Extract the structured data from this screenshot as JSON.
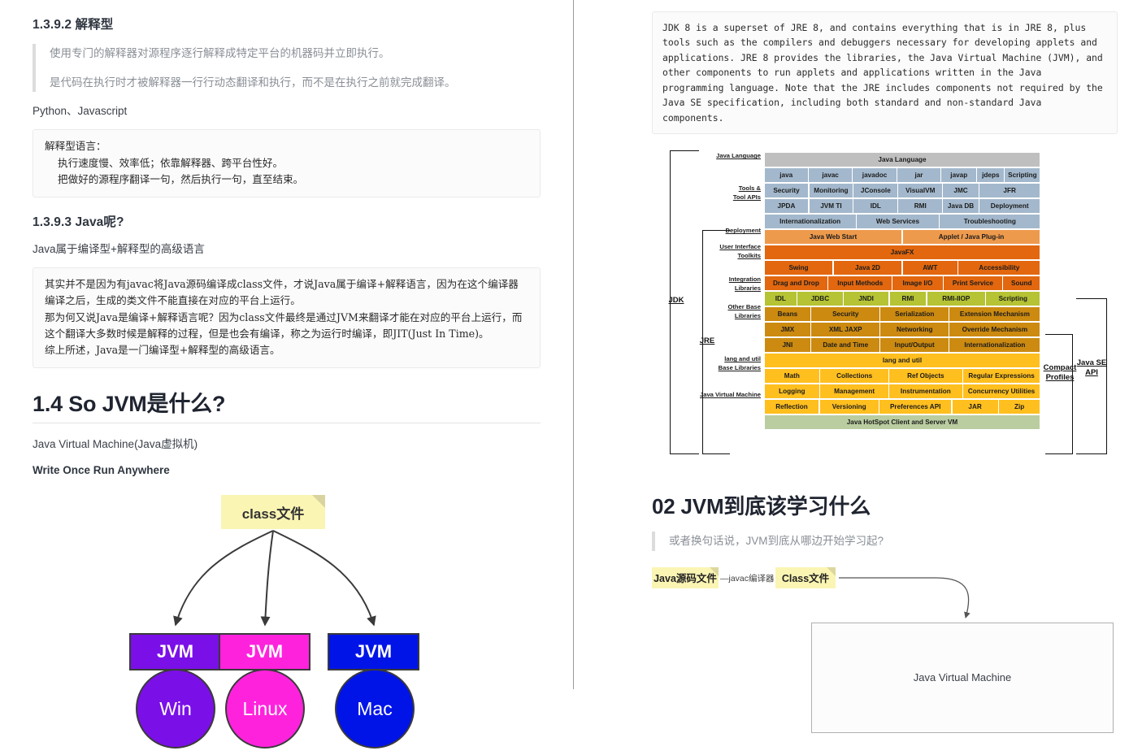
{
  "left": {
    "heading_interpreted": "1.3.9.2 解释型",
    "quote_interpreted": [
      "使用专门的解释器对源程序逐行解释成特定平台的机器码并立即执行。",
      "是代码在执行时才被解释器一行行动态翻译和执行，而不是在执行之前就完成翻译。"
    ],
    "languages_line": "Python、Javascript",
    "code_interpreted": "解释型语言：\n    执行速度慢、效率低；依靠解释器、跨平台性好。\n    把做好的源程序翻译一句，然后执行一句，直至结束。",
    "heading_java": "1.3.9.3 Java呢?",
    "java_line": "Java属于编译型+解释型的高级语言",
    "code_java": "其实并不是因为有javac将Java源码编译成class文件，才说Java属于编译+解释语言，因为在这个编译器编译之后，生成的类文件不能直接在对应的平台上运行。\n那为何又说Java是编译+解释语言呢？因为class文件最终是通过JVM来翻译才能在对应的平台上运行，而这个翻译大多数时候是解释的过程，但是也会有编译，称之为运行时编译，即JIT(Just In Time)。\n综上所述，Java是一门编译型+解释型的高级语言。",
    "heading_jvm": "1.4 So JVM是什么?",
    "jvm_subtitle": "Java Virtual Machine(Java虚拟机)",
    "jvm_motto": "Write Once Run Anywhere",
    "diagram": {
      "source_note": "class文件",
      "jvm_label": "JVM",
      "platforms": [
        {
          "name": "Win",
          "color": "#7B0FE8"
        },
        {
          "name": "Linux",
          "color": "#FF22DD"
        },
        {
          "name": "Mac",
          "color": "#0014E8"
        }
      ]
    }
  },
  "right": {
    "jdk_description": "JDK 8 is a superset of JRE 8, and contains everything that is in JRE 8, plus tools such as the compilers and debuggers necessary for developing applets and applications. JRE 8 provides the libraries, the Java Virtual Machine (JVM), and other components to run applets and applications written in the Java programming language. Note that the JRE includes components not required by the Java SE specification, including both standard and non-standard Java components.",
    "jdk_diagram": {
      "brackets": {
        "jdk": "JDK",
        "jre": "JRE",
        "java_se_api": "Java SE\nAPI",
        "compact_profiles": "Compact\nProfiles"
      },
      "left_labels": [
        "Java Language",
        "Tools &\nTool APIs",
        "Deployment",
        "User Interface\nToolkits",
        "Integration\nLibraries",
        "Other Base\nLibraries",
        "lang and util\nBase Libraries",
        "Java Virtual Machine"
      ],
      "colors": {
        "java_language": "#BFBFBF",
        "tools": "#A3B8CC",
        "deployment": "#EE9A4D",
        "ui_toolkits": "#E2670F",
        "integration": "#B5C334",
        "other_base": "#CC8A10",
        "lang_util": "#FFBF1F",
        "jvm": "#BACDA0"
      },
      "rows": [
        {
          "group": "java_language",
          "cells": [
            {
              "t": "Java Language",
              "w": 12
            }
          ]
        },
        {
          "group": "tools",
          "cells": [
            {
              "t": "java",
              "w": 2
            },
            {
              "t": "javac",
              "w": 2
            },
            {
              "t": "javadoc",
              "w": 2
            },
            {
              "t": "jar",
              "w": 2
            },
            {
              "t": "javap",
              "w": 1.6
            },
            {
              "t": "jdeps",
              "w": 1.2
            },
            {
              "t": "Scripting",
              "w": 1.6
            }
          ]
        },
        {
          "group": "tools",
          "cells": [
            {
              "t": "Security",
              "w": 2
            },
            {
              "t": "Monitoring",
              "w": 2
            },
            {
              "t": "JConsole",
              "w": 2
            },
            {
              "t": "VisualVM",
              "w": 2
            },
            {
              "t": "JMC",
              "w": 1.6
            },
            {
              "t": "JFR",
              "w": 2.8
            }
          ]
        },
        {
          "group": "tools",
          "cells": [
            {
              "t": "JPDA",
              "w": 2
            },
            {
              "t": "JVM TI",
              "w": 2
            },
            {
              "t": "IDL",
              "w": 2
            },
            {
              "t": "RMI",
              "w": 2
            },
            {
              "t": "Java DB",
              "w": 1.6
            },
            {
              "t": "Deployment",
              "w": 2.8
            }
          ]
        },
        {
          "group": "tools",
          "cells": [
            {
              "t": "Internationalization",
              "w": 4
            },
            {
              "t": "Web Services",
              "w": 3.6
            },
            {
              "t": "Troubleshooting",
              "w": 4.4
            }
          ]
        },
        {
          "group": "deployment",
          "cells": [
            {
              "t": "Java Web Start",
              "w": 6
            },
            {
              "t": "Applet / Java Plug-in",
              "w": 6
            }
          ]
        },
        {
          "group": "ui_toolkits",
          "cells": [
            {
              "t": "JavaFX",
              "w": 12
            }
          ]
        },
        {
          "group": "ui_toolkits",
          "cells": [
            {
              "t": "Swing",
              "w": 3
            },
            {
              "t": "Java 2D",
              "w": 3
            },
            {
              "t": "AWT",
              "w": 2.4
            },
            {
              "t": "Accessibility",
              "w": 3.6
            }
          ]
        },
        {
          "group": "ui_toolkits",
          "cells": [
            {
              "t": "Drag and Drop",
              "w": 2.8
            },
            {
              "t": "Input Methods",
              "w": 2.8
            },
            {
              "t": "Image I/O",
              "w": 2.2
            },
            {
              "t": "Print Service",
              "w": 2.6
            },
            {
              "t": "Sound",
              "w": 1.6
            }
          ]
        },
        {
          "group": "integration",
          "cells": [
            {
              "t": "IDL",
              "w": 1.4
            },
            {
              "t": "JDBC",
              "w": 2
            },
            {
              "t": "JNDI",
              "w": 2
            },
            {
              "t": "RMI",
              "w": 1.6
            },
            {
              "t": "RMI-IIOP",
              "w": 2.6
            },
            {
              "t": "Scripting",
              "w": 2.4
            }
          ]
        },
        {
          "group": "other_base",
          "cells": [
            {
              "t": "Beans",
              "w": 2
            },
            {
              "t": "Security",
              "w": 3
            },
            {
              "t": "Serialization",
              "w": 3
            },
            {
              "t": "Extension Mechanism",
              "w": 4
            }
          ]
        },
        {
          "group": "other_base",
          "cells": [
            {
              "t": "JMX",
              "w": 2
            },
            {
              "t": "XML JAXP",
              "w": 3
            },
            {
              "t": "Networking",
              "w": 3
            },
            {
              "t": "Override Mechanism",
              "w": 4
            }
          ]
        },
        {
          "group": "other_base",
          "cells": [
            {
              "t": "JNI",
              "w": 2
            },
            {
              "t": "Date and Time",
              "w": 3
            },
            {
              "t": "Input/Output",
              "w": 3
            },
            {
              "t": "Internationalization",
              "w": 4
            }
          ]
        },
        {
          "group": "lang_util",
          "cells": [
            {
              "t": "lang and util",
              "w": 12
            }
          ]
        },
        {
          "group": "lang_util",
          "cells": [
            {
              "t": "Math",
              "w": 2.4
            },
            {
              "t": "Collections",
              "w": 3
            },
            {
              "t": "Ref Objects",
              "w": 3.2
            },
            {
              "t": "Regular Expressions",
              "w": 3.4
            }
          ]
        },
        {
          "group": "lang_util",
          "cells": [
            {
              "t": "Logging",
              "w": 2.4
            },
            {
              "t": "Management",
              "w": 3
            },
            {
              "t": "Instrumentation",
              "w": 3.2
            },
            {
              "t": "Concurrency Utilities",
              "w": 3.4
            }
          ]
        },
        {
          "group": "lang_util",
          "cells": [
            {
              "t": "Reflection",
              "w": 2.4
            },
            {
              "t": "Versioning",
              "w": 2.6
            },
            {
              "t": "Preferences API",
              "w": 3.2
            },
            {
              "t": "JAR",
              "w": 2
            },
            {
              "t": "Zip",
              "w": 1.8
            }
          ]
        },
        {
          "group": "jvm",
          "cells": [
            {
              "t": "Java HotSpot Client and Server VM",
              "w": 12
            }
          ]
        }
      ]
    },
    "section_heading": "02 JVM到底该学习什么",
    "section_quote": "或者换句话说，JVM到底从哪边开始学习起?",
    "flow": {
      "source_note": "Java源码文件",
      "edge_label": "—javac编译器→",
      "class_note": "Class文件",
      "jvm_box": "Java Virtual Machine"
    }
  }
}
